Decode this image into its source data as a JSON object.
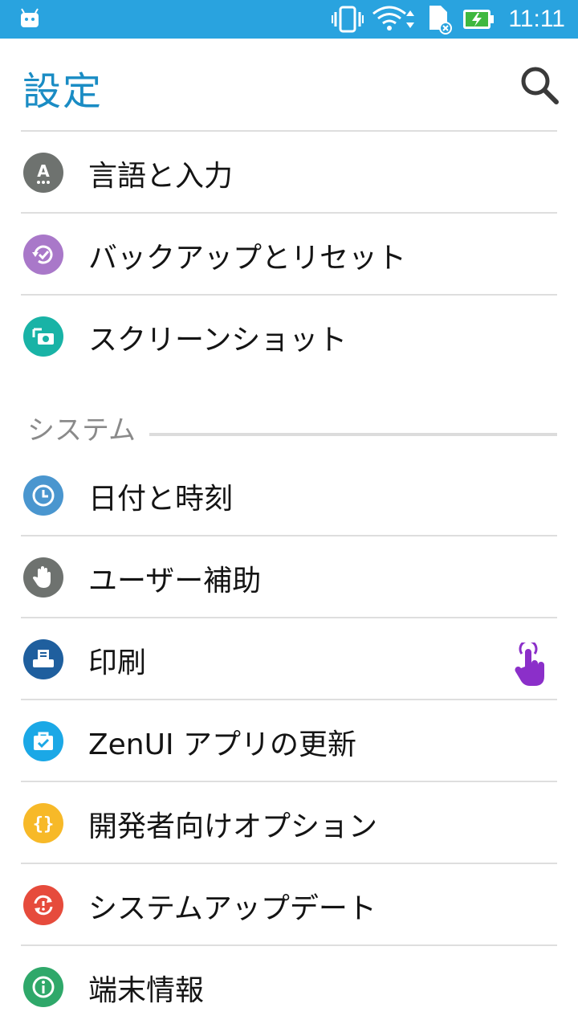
{
  "status_bar": {
    "time": "11:11",
    "icons": [
      "android-notification-icon",
      "vibrate-icon",
      "wifi-icon",
      "sd-card-icon",
      "battery-charging-icon"
    ]
  },
  "header": {
    "title": "設定",
    "search_icon": "search-icon"
  },
  "items_top": [
    {
      "label": "言語と入力",
      "icon": "language-icon",
      "color": "#6e726f"
    },
    {
      "label": "バックアップとリセット",
      "icon": "backup-icon",
      "color": "#a978c9"
    },
    {
      "label": "スクリーンショット",
      "icon": "screenshot-icon",
      "color": "#19b3a6"
    }
  ],
  "section_system": {
    "title": "システム",
    "items": [
      {
        "label": "日付と時刻",
        "icon": "clock-icon",
        "color": "#4a96cf"
      },
      {
        "label": "ユーザー補助",
        "icon": "hand-icon",
        "color": "#6e726f"
      },
      {
        "label": "印刷",
        "icon": "print-icon",
        "color": "#1f5f9e"
      },
      {
        "label": "ZenUI アプリの更新",
        "icon": "update-bag-icon",
        "color": "#1ba8e6"
      },
      {
        "label": "開発者向けオプション",
        "icon": "developer-braces-icon",
        "color": "#f7b928"
      },
      {
        "label": "システムアップデート",
        "icon": "system-update-icon",
        "color": "#e64b3c"
      },
      {
        "label": "端末情報",
        "icon": "info-icon",
        "color": "#2fa86a"
      }
    ]
  },
  "overlay": {
    "touch_pointer_icon": "touch-pointer-icon",
    "color": "#8b2fc9"
  }
}
